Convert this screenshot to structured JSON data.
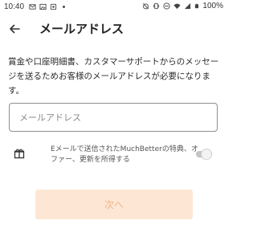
{
  "status_bar": {
    "time": "10:40",
    "battery": "100%",
    "left_icons": [
      "mail-icon",
      "image-icon",
      "notification-icon",
      "dot-icon"
    ],
    "right_icons": [
      "alarm-off-icon",
      "vibrate-icon",
      "minus-circle-icon",
      "wifi-icon",
      "signal-icon",
      "battery-icon"
    ]
  },
  "header": {
    "back_icon": "arrow-left-icon",
    "title": "メールアドレス"
  },
  "description": "賞金や口座明細書、カスタマーサポートからのメッセージを送るためお客様のメールアドレスが必要になります。",
  "email_field": {
    "placeholder": "メールアドレス",
    "value": ""
  },
  "optin": {
    "icon": "gift-icon",
    "text": "Eメールで送信されたMuchBetterの特典、オファー、更新を所得する",
    "toggle_on": false
  },
  "next_button": {
    "label": "次へ",
    "enabled": false
  },
  "colors": {
    "button_bg": "#fde7d4",
    "button_text": "#f0b58a",
    "toggle_track": "#c4c4c4"
  }
}
